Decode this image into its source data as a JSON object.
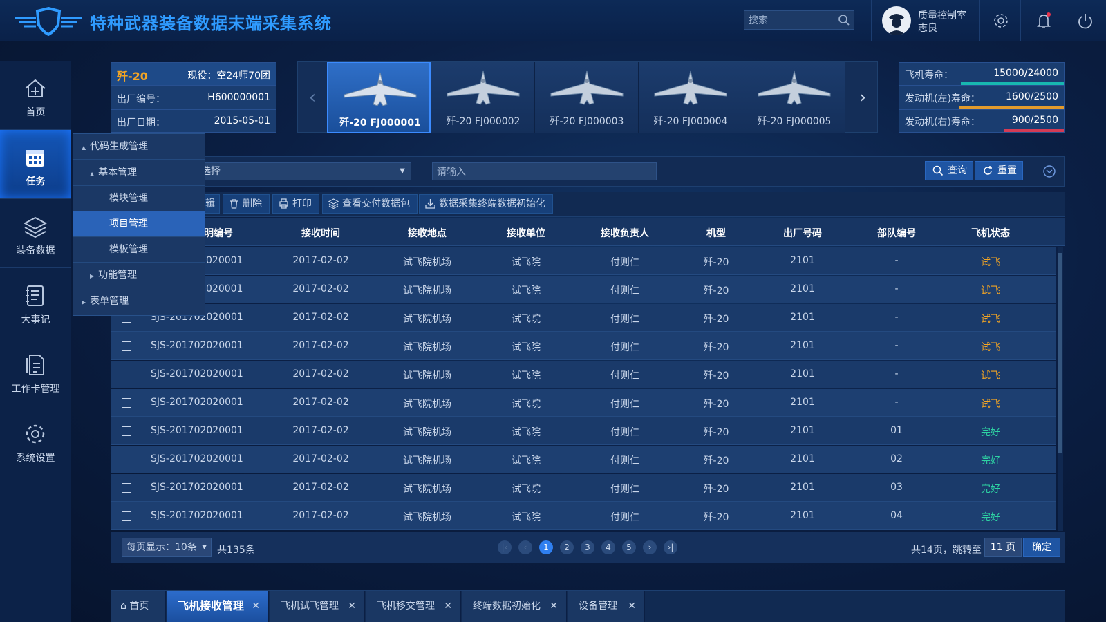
{
  "header": {
    "title": "特种武器装备数据末端采集系统",
    "search_placeholder": "搜索",
    "user_role": "质量控制室",
    "user_name": "志良"
  },
  "sidebar": {
    "items": [
      {
        "label": "首页",
        "icon": "home-icon"
      },
      {
        "label": "任务",
        "icon": "calendar-icon",
        "active": true
      },
      {
        "label": "装备数据",
        "icon": "layers-icon"
      },
      {
        "label": "大事记",
        "icon": "notebook-icon"
      },
      {
        "label": "工作卡管理",
        "icon": "document-icon"
      },
      {
        "label": "系统设置",
        "icon": "gear-icon"
      }
    ]
  },
  "menu": {
    "items": [
      {
        "label": "代码生成管理",
        "level": 0,
        "tri": "▲"
      },
      {
        "label": "基本管理",
        "level": 1,
        "tri": "▲"
      },
      {
        "label": "模块管理",
        "level": 2
      },
      {
        "label": "项目管理",
        "level": 2,
        "selected": true
      },
      {
        "label": "模板管理",
        "level": 2
      },
      {
        "label": "功能管理",
        "level": 1,
        "tri": "▶"
      },
      {
        "label": "表单管理",
        "level": 0,
        "tri": "▶"
      }
    ]
  },
  "aircraft_info": {
    "model": "歼-20",
    "service": "现役：空24师70团",
    "serial_label": "出厂编号：",
    "serial": "H600000001",
    "date_label": "出厂日期：",
    "date": "2015-05-01"
  },
  "carousel": {
    "items": [
      "歼-20 FJ000001",
      "歼-20 FJ000002",
      "歼-20 FJ000003",
      "歼-20 FJ000004",
      "歼-20 FJ000005"
    ],
    "selected": 0
  },
  "life": [
    {
      "label": "飞机寿命：",
      "value": "15000/24000",
      "fraction": 0.625,
      "color": "#18b7b0"
    },
    {
      "label": "发动机(左)寿命：",
      "value": "1600/2500",
      "fraction": 0.64,
      "color": "#e39b2c"
    },
    {
      "label": "发动机(右)寿命：",
      "value": "900/2500",
      "fraction": 0.36,
      "color": "#d43b55"
    }
  ],
  "filter": {
    "select_placeholder": "选择",
    "input_placeholder": "请输入",
    "query_label": "查询",
    "reset_label": "重置"
  },
  "toolbar": {
    "buttons": [
      "删除",
      "打印",
      "查看交付数据包",
      "数据采集终端数据初始化"
    ],
    "partial_label": "辑"
  },
  "table": {
    "headers": [
      "明编号",
      "接收时间",
      "接收地点",
      "接收单位",
      "接收负责人",
      "机型",
      "出厂号码",
      "部队编号",
      "飞机状态"
    ],
    "rows": [
      [
        "020001",
        "2017-02-02",
        "试飞院机场",
        "试飞院",
        "付则仁",
        "歼-20",
        "2101",
        "-",
        "试飞"
      ],
      [
        "020001",
        "2017-02-02",
        "试飞院机场",
        "试飞院",
        "付则仁",
        "歼-20",
        "2101",
        "-",
        "试飞"
      ],
      [
        "SJS-201702020001",
        "2017-02-02",
        "试飞院机场",
        "试飞院",
        "付则仁",
        "歼-20",
        "2101",
        "-",
        "试飞"
      ],
      [
        "SJS-201702020001",
        "2017-02-02",
        "试飞院机场",
        "试飞院",
        "付则仁",
        "歼-20",
        "2101",
        "-",
        "试飞"
      ],
      [
        "SJS-201702020001",
        "2017-02-02",
        "试飞院机场",
        "试飞院",
        "付则仁",
        "歼-20",
        "2101",
        "-",
        "试飞"
      ],
      [
        "SJS-201702020001",
        "2017-02-02",
        "试飞院机场",
        "试飞院",
        "付则仁",
        "歼-20",
        "2101",
        "-",
        "试飞"
      ],
      [
        "SJS-201702020001",
        "2017-02-02",
        "试飞院机场",
        "试飞院",
        "付则仁",
        "歼-20",
        "2101",
        "01",
        "完好"
      ],
      [
        "SJS-201702020001",
        "2017-02-02",
        "试飞院机场",
        "试飞院",
        "付则仁",
        "歼-20",
        "2101",
        "02",
        "完好"
      ],
      [
        "SJS-201702020001",
        "2017-02-02",
        "试飞院机场",
        "试飞院",
        "付则仁",
        "歼-20",
        "2101",
        "03",
        "完好"
      ],
      [
        "SJS-201702020001",
        "2017-02-02",
        "试飞院机场",
        "试飞院",
        "付则仁",
        "歼-20",
        "2101",
        "04",
        "完好"
      ]
    ]
  },
  "pager": {
    "per_page": "每页显示：10条",
    "total": "共135条",
    "pages": [
      "1",
      "2",
      "3",
      "4",
      "5"
    ],
    "current": "1",
    "pages_text": "共14页，跳转至",
    "jump_value": "11 页",
    "confirm": "确定"
  },
  "tabs": [
    {
      "label": "首页"
    },
    {
      "label": "飞机接收管理",
      "selected": true
    },
    {
      "label": "飞机试飞管理"
    },
    {
      "label": "飞机移交管理"
    },
    {
      "label": "终端数据初始化"
    },
    {
      "label": "设备管理"
    }
  ],
  "colors": {
    "accent": "#2f7ff0",
    "title": "#2f9bff",
    "status_test": "#f5a623",
    "status_ok": "#2ed3a3"
  }
}
